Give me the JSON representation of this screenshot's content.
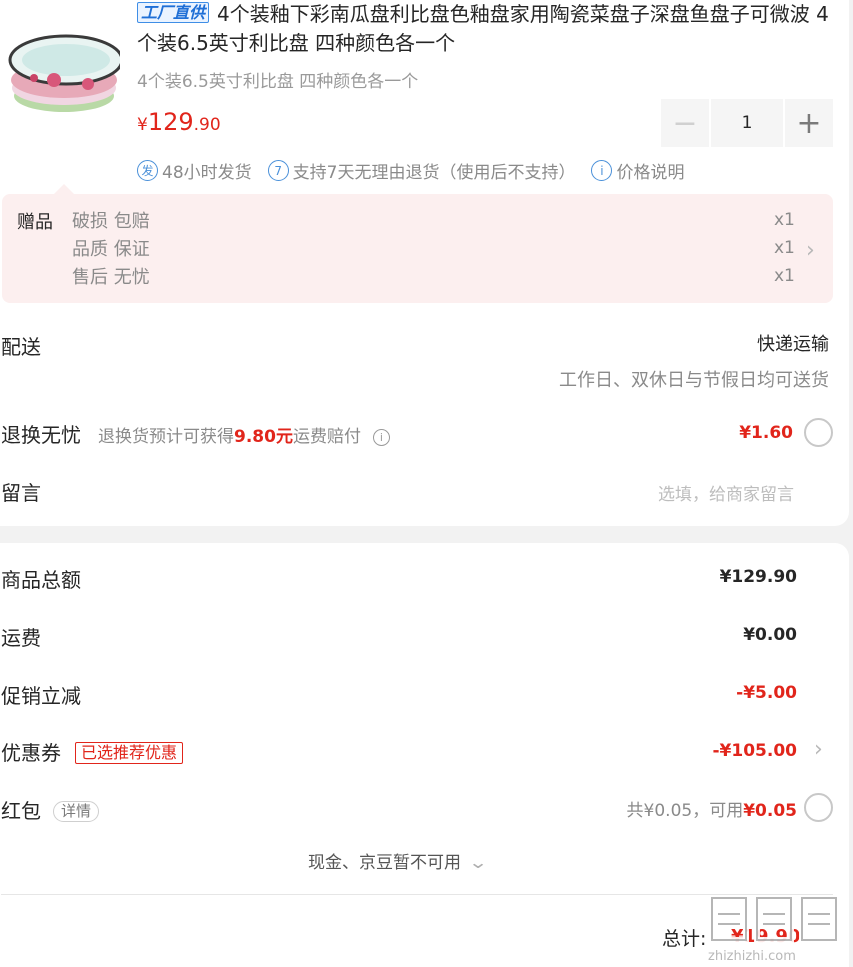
{
  "product": {
    "factory_tag": "工厂直供",
    "title": "4个装釉下彩南瓜盘利比盘色釉盘家用陶瓷菜盘子深盘鱼盘子可微波 4个装6.5英寸利比盘 四种颜色各一个",
    "spec": "4个装6.5英寸利比盘 四种颜色各一个",
    "price_symbol": "¥",
    "price_int": "129",
    "price_dec": ".90",
    "quantity": "1",
    "services": [
      {
        "icon": "发",
        "text": "48小时发货"
      },
      {
        "icon": "7",
        "text": "支持7天无理由退货（使用后不支持）"
      },
      {
        "icon": "i",
        "text": "价格说明"
      }
    ]
  },
  "gift": {
    "label": "赠品",
    "items": [
      {
        "name": "破损 包赔",
        "qty": "x1"
      },
      {
        "name": "品质 保证",
        "qty": "x1"
      },
      {
        "name": "售后 无忧",
        "qty": "x1"
      }
    ]
  },
  "delivery": {
    "label": "配送",
    "type": "快递运输",
    "note": "工作日、双休日与节假日均可送货"
  },
  "return_worry": {
    "label": "退换无忧",
    "desc_prefix": "退换货预计可获得",
    "desc_amount": "9.80元",
    "desc_suffix": "运费赔付",
    "price": "¥1.60"
  },
  "message": {
    "label": "留言",
    "placeholder": "选填，给商家留言"
  },
  "summary": {
    "goods_label": "商品总额",
    "goods_value": "¥129.90",
    "shipping_label": "运费",
    "shipping_value": "¥0.00",
    "promo_label": "促销立减",
    "promo_value": "-¥5.00",
    "coupon_label": "优惠券",
    "coupon_tag": "已选推荐优惠",
    "coupon_value": "-¥105.00",
    "hongbao_label": "红包",
    "hongbao_detail": "详情",
    "hongbao_prefix": "共¥0.05，可用",
    "hongbao_value": "¥0.05",
    "cash_note": "现金、京豆暂不可用",
    "total_label": "总计:",
    "total_value": "¥19.90"
  },
  "watermark": "值 什么值得买 zhizhizhi.com",
  "colors": {
    "accent": "#e1251b",
    "info_blue": "#4a90d9",
    "gift_bg": "#fcefef"
  }
}
